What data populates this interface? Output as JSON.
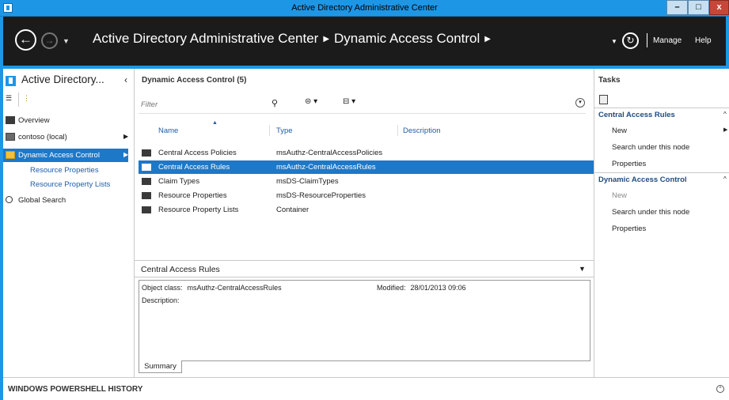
{
  "window": {
    "title": "Active Directory Administrative Center",
    "min_glyph": "–",
    "max_glyph": "□",
    "close_glyph": "x"
  },
  "header": {
    "breadcrumb": [
      "Active Directory Administrative Center",
      "Dynamic Access Control"
    ],
    "manage": "Manage",
    "help": "Help"
  },
  "leftnav": {
    "title": "Active Directory...",
    "items": [
      {
        "label": "Overview",
        "icon": "overview-icon"
      },
      {
        "label": "contoso (local)",
        "icon": "domain-icon"
      },
      {
        "label": "Dynamic Access Control",
        "icon": "folder-icon",
        "selected": true
      },
      {
        "label": "Resource Properties"
      },
      {
        "label": "Resource Property Lists"
      },
      {
        "label": "Global Search",
        "icon": "search-icon"
      }
    ]
  },
  "center": {
    "title": "Dynamic Access Control  (5)",
    "filter_placeholder": "Filter",
    "columns": [
      "Name",
      "Type",
      "Description"
    ],
    "rows": [
      {
        "name": "Central Access Policies",
        "type": "msAuthz-CentralAccessPolicies",
        "description": ""
      },
      {
        "name": "Central Access Rules",
        "type": "msAuthz-CentralAccessRules",
        "description": "",
        "selected": true
      },
      {
        "name": "Claim Types",
        "type": "msDS-ClaimTypes",
        "description": ""
      },
      {
        "name": "Resource Properties",
        "type": "msDS-ResourceProperties",
        "description": ""
      },
      {
        "name": "Resource Property Lists",
        "type": "Container",
        "description": ""
      }
    ],
    "preview": {
      "title": "Central Access Rules",
      "object_class_label": "Object class:",
      "object_class_value": "msAuthz-CentralAccessRules",
      "modified_label": "Modified:",
      "modified_value": "28/01/2013 09:06",
      "description_label": "Description:",
      "tab": "Summary"
    }
  },
  "tasks": {
    "title": "Tasks",
    "groups": [
      {
        "label": "Central Access Rules",
        "items": [
          {
            "label": "New",
            "has_submenu": true,
            "enabled": true
          },
          {
            "label": "Search under this node",
            "enabled": true
          },
          {
            "label": "Properties",
            "enabled": true
          }
        ]
      },
      {
        "label": "Dynamic Access Control",
        "items": [
          {
            "label": "New",
            "enabled": false
          },
          {
            "label": "Search under this node",
            "enabled": true
          },
          {
            "label": "Properties",
            "enabled": true
          }
        ]
      }
    ]
  },
  "footer": {
    "powershell": "WINDOWS POWERSHELL HISTORY"
  },
  "colors": {
    "accent": "#1e96e6",
    "selection": "#1e78c8",
    "header_bg": "#1b1b1b"
  }
}
